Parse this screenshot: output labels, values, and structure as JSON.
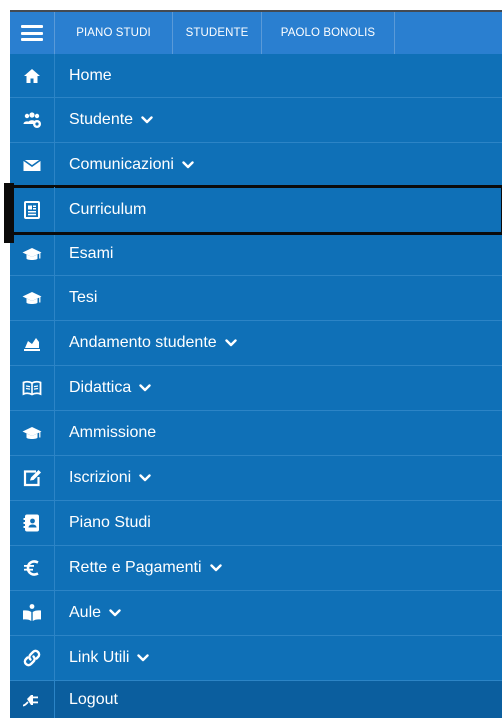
{
  "topbar": {
    "menu_icon": "hamburger-menu-icon",
    "breadcrumbs": [
      "PIANO STUDI",
      "STUDENTE",
      "PAOLO BONOLIS"
    ]
  },
  "menu": {
    "items": [
      {
        "label": "Home",
        "icon": "home-icon",
        "has_submenu": false
      },
      {
        "label": "Studente",
        "icon": "users-icon",
        "has_submenu": true
      },
      {
        "label": "Comunicazioni",
        "icon": "envelope-icon",
        "has_submenu": true
      },
      {
        "label": "Curriculum",
        "icon": "document-icon",
        "has_submenu": false,
        "active": true
      },
      {
        "label": "Esami",
        "icon": "graduation-cap-icon",
        "has_submenu": false
      },
      {
        "label": "Tesi",
        "icon": "graduation-cap-icon",
        "has_submenu": false
      },
      {
        "label": "Andamento studente",
        "icon": "chart-area-icon",
        "has_submenu": true
      },
      {
        "label": "Didattica",
        "icon": "book-icon",
        "has_submenu": true
      },
      {
        "label": "Ammissione",
        "icon": "graduation-cap-icon",
        "has_submenu": false
      },
      {
        "label": "Iscrizioni",
        "icon": "edit-icon",
        "has_submenu": true
      },
      {
        "label": "Piano Studi",
        "icon": "address-book-icon",
        "has_submenu": false
      },
      {
        "label": "Rette e Pagamenti",
        "icon": "euro-icon",
        "has_submenu": true
      },
      {
        "label": "Aule",
        "icon": "reader-icon",
        "has_submenu": true
      },
      {
        "label": "Link Utili",
        "icon": "link-icon",
        "has_submenu": true
      },
      {
        "label": "Logout",
        "icon": "plug-icon",
        "has_submenu": false
      }
    ]
  },
  "colors": {
    "topbar": "#2a7fd0",
    "menu": "#0f70b7",
    "logout_row": "#0b5e9e",
    "active_outline": "#0b0b0b",
    "text": "#ffffff"
  }
}
